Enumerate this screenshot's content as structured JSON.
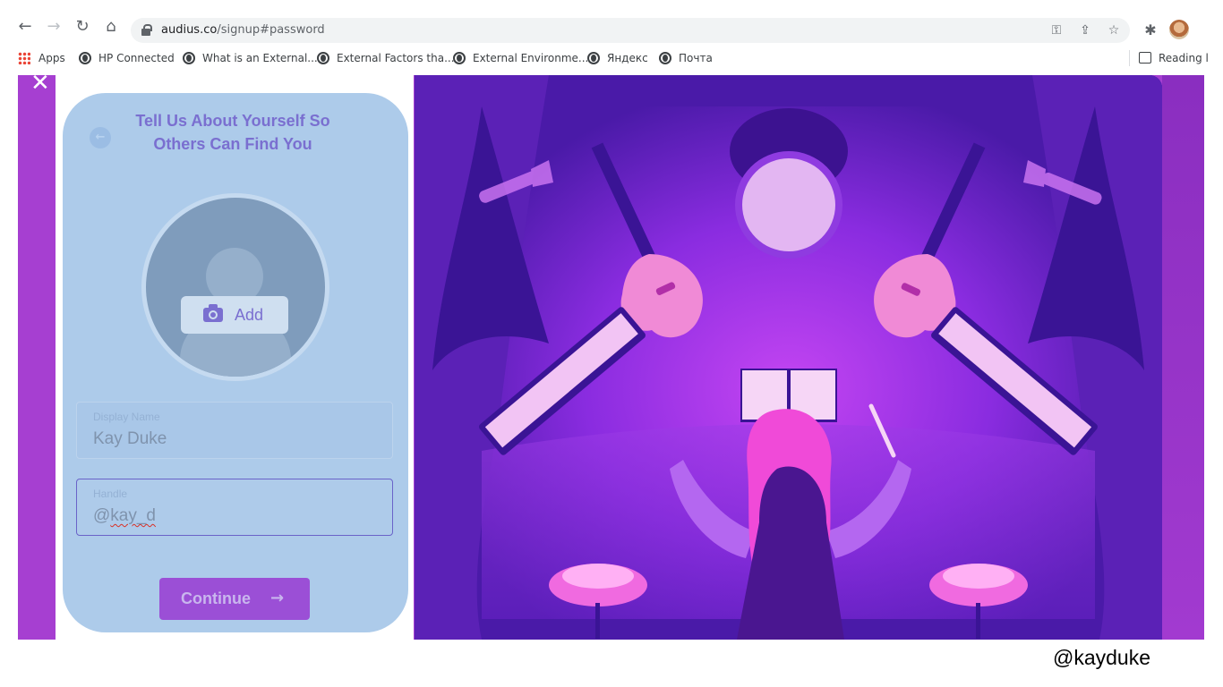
{
  "browser": {
    "url_host": "audius.co",
    "url_path": "/signup#password",
    "bookmarks": [
      {
        "label": "Apps",
        "icon": "apps-grid-icon"
      },
      {
        "label": "HP Connected",
        "icon": "globe-icon"
      },
      {
        "label": "What is an External...",
        "icon": "globe-icon"
      },
      {
        "label": "External Factors tha...",
        "icon": "globe-icon"
      },
      {
        "label": "External Environme...",
        "icon": "globe-icon"
      },
      {
        "label": "Яндекс",
        "icon": "globe-icon"
      },
      {
        "label": "Почта",
        "icon": "globe-icon"
      }
    ],
    "reading_list": "Reading l"
  },
  "signup": {
    "close": "✕",
    "back": "←",
    "title_line1": "Tell Us About Yourself So",
    "title_line2": "Others Can Find You",
    "add_photo": "Add",
    "display_name": {
      "label": "Display Name",
      "value": "Kay Duke"
    },
    "handle": {
      "label": "Handle",
      "prefix": "@",
      "value": "kay_d"
    },
    "continue": "Continue",
    "continue_icon": "→"
  },
  "colors": {
    "page_purple": "#a63fd1",
    "card_blue": "#adcbea",
    "accent": "#7a6fd0",
    "button": "#9b4fd6"
  },
  "footer": {
    "handle": "@kayduke"
  }
}
